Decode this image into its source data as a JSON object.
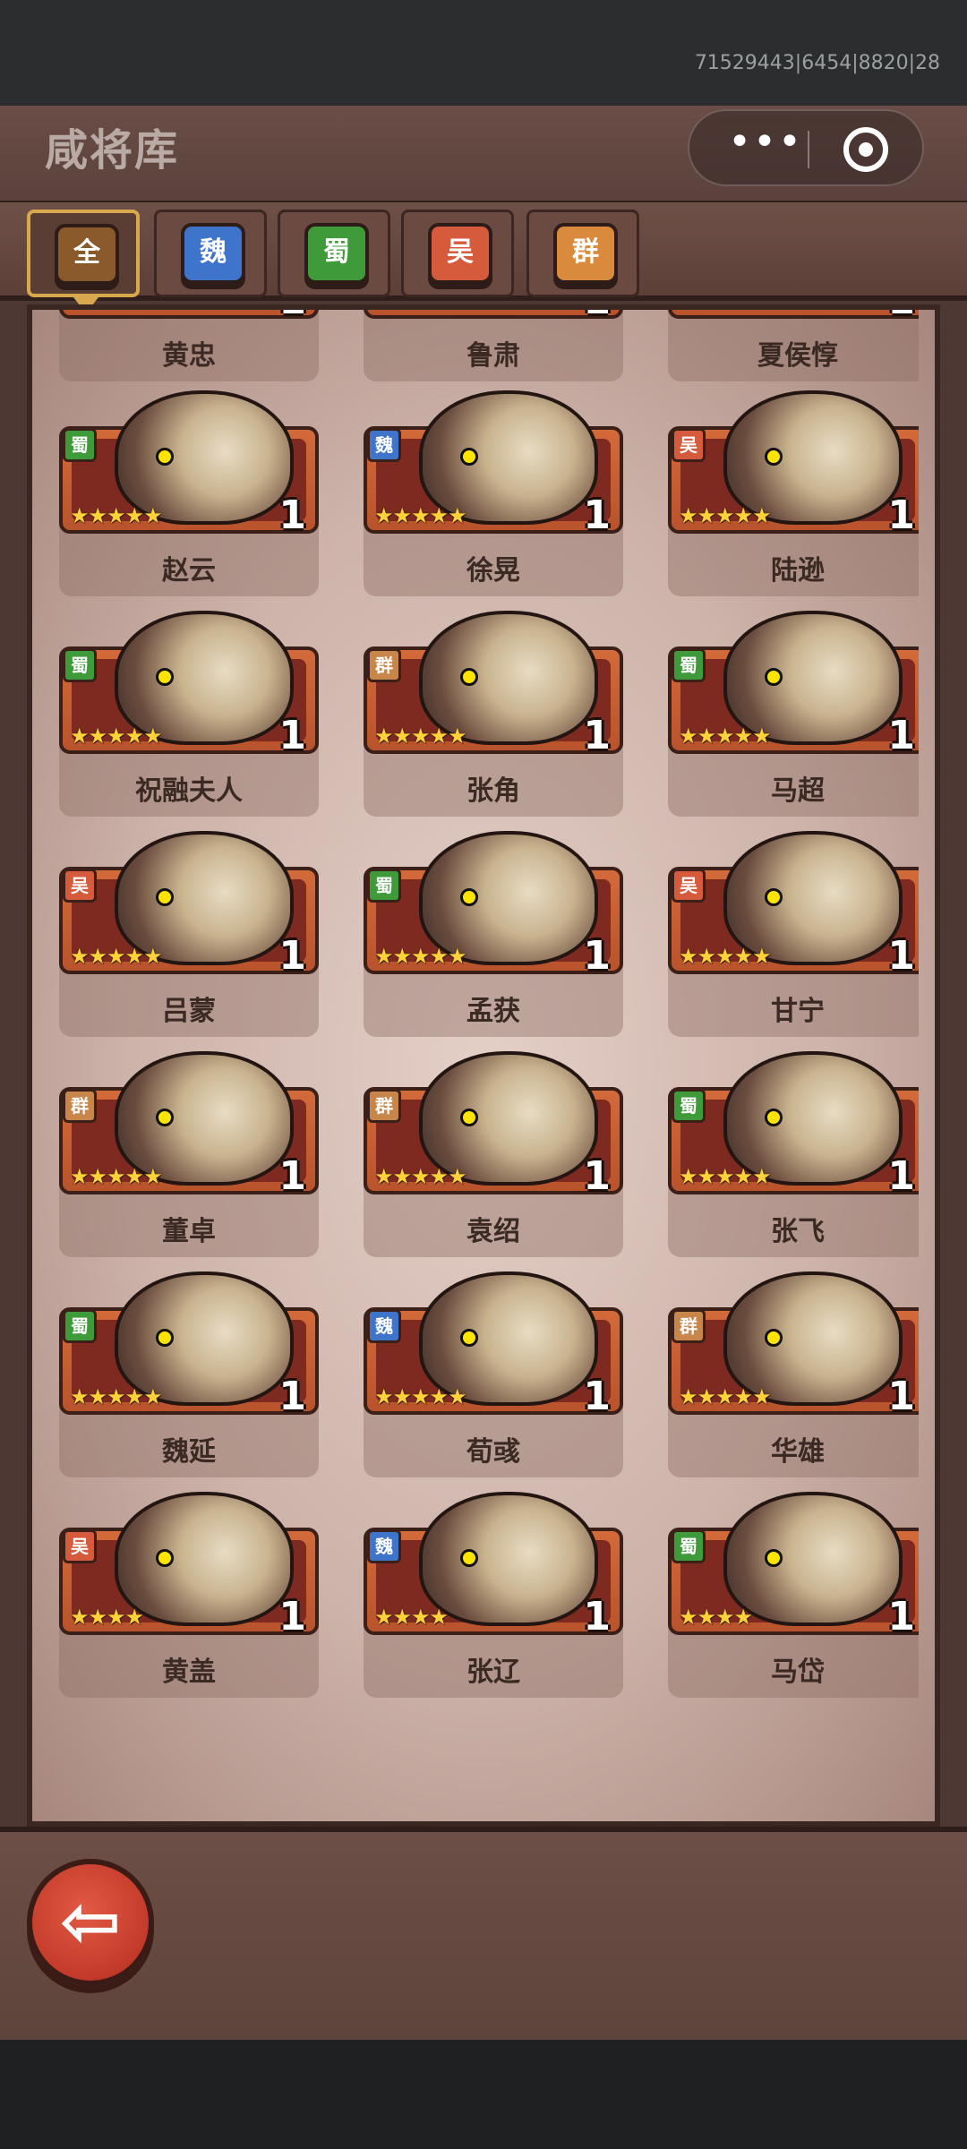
{
  "status": {
    "id_text": "71529443|6454|8820|28"
  },
  "header": {
    "title": "咸将库"
  },
  "capsule": {
    "more": "•••",
    "close_icon": "target-circle-icon"
  },
  "tabs": [
    {
      "label": "全",
      "color": "#8b5a2b",
      "active": true
    },
    {
      "label": "魏",
      "color": "#3e74c9",
      "active": false
    },
    {
      "label": "蜀",
      "color": "#3f9b3a",
      "active": false
    },
    {
      "label": "吴",
      "color": "#d65a3c",
      "active": false
    },
    {
      "label": "群",
      "color": "#d98a3c",
      "active": false
    }
  ],
  "heroes": [
    {
      "name": "黄忠",
      "faction": "",
      "stars": "★★★★★",
      "level": "1"
    },
    {
      "name": "鲁肃",
      "faction": "",
      "stars": "★★★★★",
      "level": "1"
    },
    {
      "name": "夏侯惇",
      "faction": "",
      "stars": "★★★★★",
      "level": "1"
    },
    {
      "name": "赵云",
      "faction": "蜀",
      "stars": "★★★★★",
      "level": "1"
    },
    {
      "name": "徐晃",
      "faction": "魏",
      "stars": "★★★★★",
      "level": "1"
    },
    {
      "name": "陆逊",
      "faction": "吴",
      "stars": "★★★★★",
      "level": "1"
    },
    {
      "name": "祝融夫人",
      "faction": "蜀",
      "stars": "★★★★★",
      "level": "1"
    },
    {
      "name": "张角",
      "faction": "群",
      "stars": "★★★★★",
      "level": "1"
    },
    {
      "name": "马超",
      "faction": "蜀",
      "stars": "★★★★★",
      "level": "1"
    },
    {
      "name": "吕蒙",
      "faction": "吴",
      "stars": "★★★★★",
      "level": "1"
    },
    {
      "name": "孟获",
      "faction": "蜀",
      "stars": "★★★★★",
      "level": "1"
    },
    {
      "name": "甘宁",
      "faction": "吴",
      "stars": "★★★★★",
      "level": "1"
    },
    {
      "name": "董卓",
      "faction": "群",
      "stars": "★★★★★",
      "level": "1"
    },
    {
      "name": "袁绍",
      "faction": "群",
      "stars": "★★★★★",
      "level": "1"
    },
    {
      "name": "张飞",
      "faction": "蜀",
      "stars": "★★★★★",
      "level": "1"
    },
    {
      "name": "魏延",
      "faction": "蜀",
      "stars": "★★★★★",
      "level": "1"
    },
    {
      "name": "荀彧",
      "faction": "魏",
      "stars": "★★★★★",
      "level": "1"
    },
    {
      "name": "华雄",
      "faction": "群",
      "stars": "★★★★★",
      "level": "1"
    },
    {
      "name": "黄盖",
      "faction": "吴",
      "stars": "★★★★",
      "level": "1"
    },
    {
      "name": "张辽",
      "faction": "魏",
      "stars": "★★★★",
      "level": "1"
    },
    {
      "name": "马岱",
      "faction": "蜀",
      "stars": "★★★★",
      "level": "1"
    }
  ],
  "faction_colors": {
    "蜀": "#3f9b3a",
    "魏": "#3e74c9",
    "吴": "#d65a3c",
    "群": "#c9864a"
  },
  "back_button": {
    "icon": "back-arrow-icon",
    "glyph": "⇦"
  }
}
